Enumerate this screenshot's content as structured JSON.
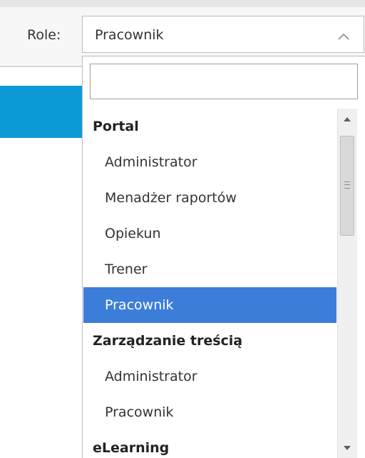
{
  "filter": {
    "label": "Role:",
    "selected_value": "Pracownik",
    "search_placeholder": ""
  },
  "dropdown": {
    "groups": [
      {
        "label": "Portal",
        "options": [
          "Administrator",
          "Menadżer raportów",
          "Opiekun",
          "Trener",
          "Pracownik"
        ]
      },
      {
        "label": "Zarządzanie treścią",
        "options": [
          "Administrator",
          "Pracownik"
        ]
      },
      {
        "label": "eLearning",
        "options": []
      }
    ],
    "selected_option": "Pracownik"
  },
  "icons": {
    "select_toggle": "chevron-up-icon",
    "scroll_up": "scroll-up-arrow-icon",
    "scroll_down": "scroll-down-arrow-icon"
  },
  "colors": {
    "accent_blue": "#0d9ad6",
    "selected_option_bg": "#3c7dd9"
  }
}
